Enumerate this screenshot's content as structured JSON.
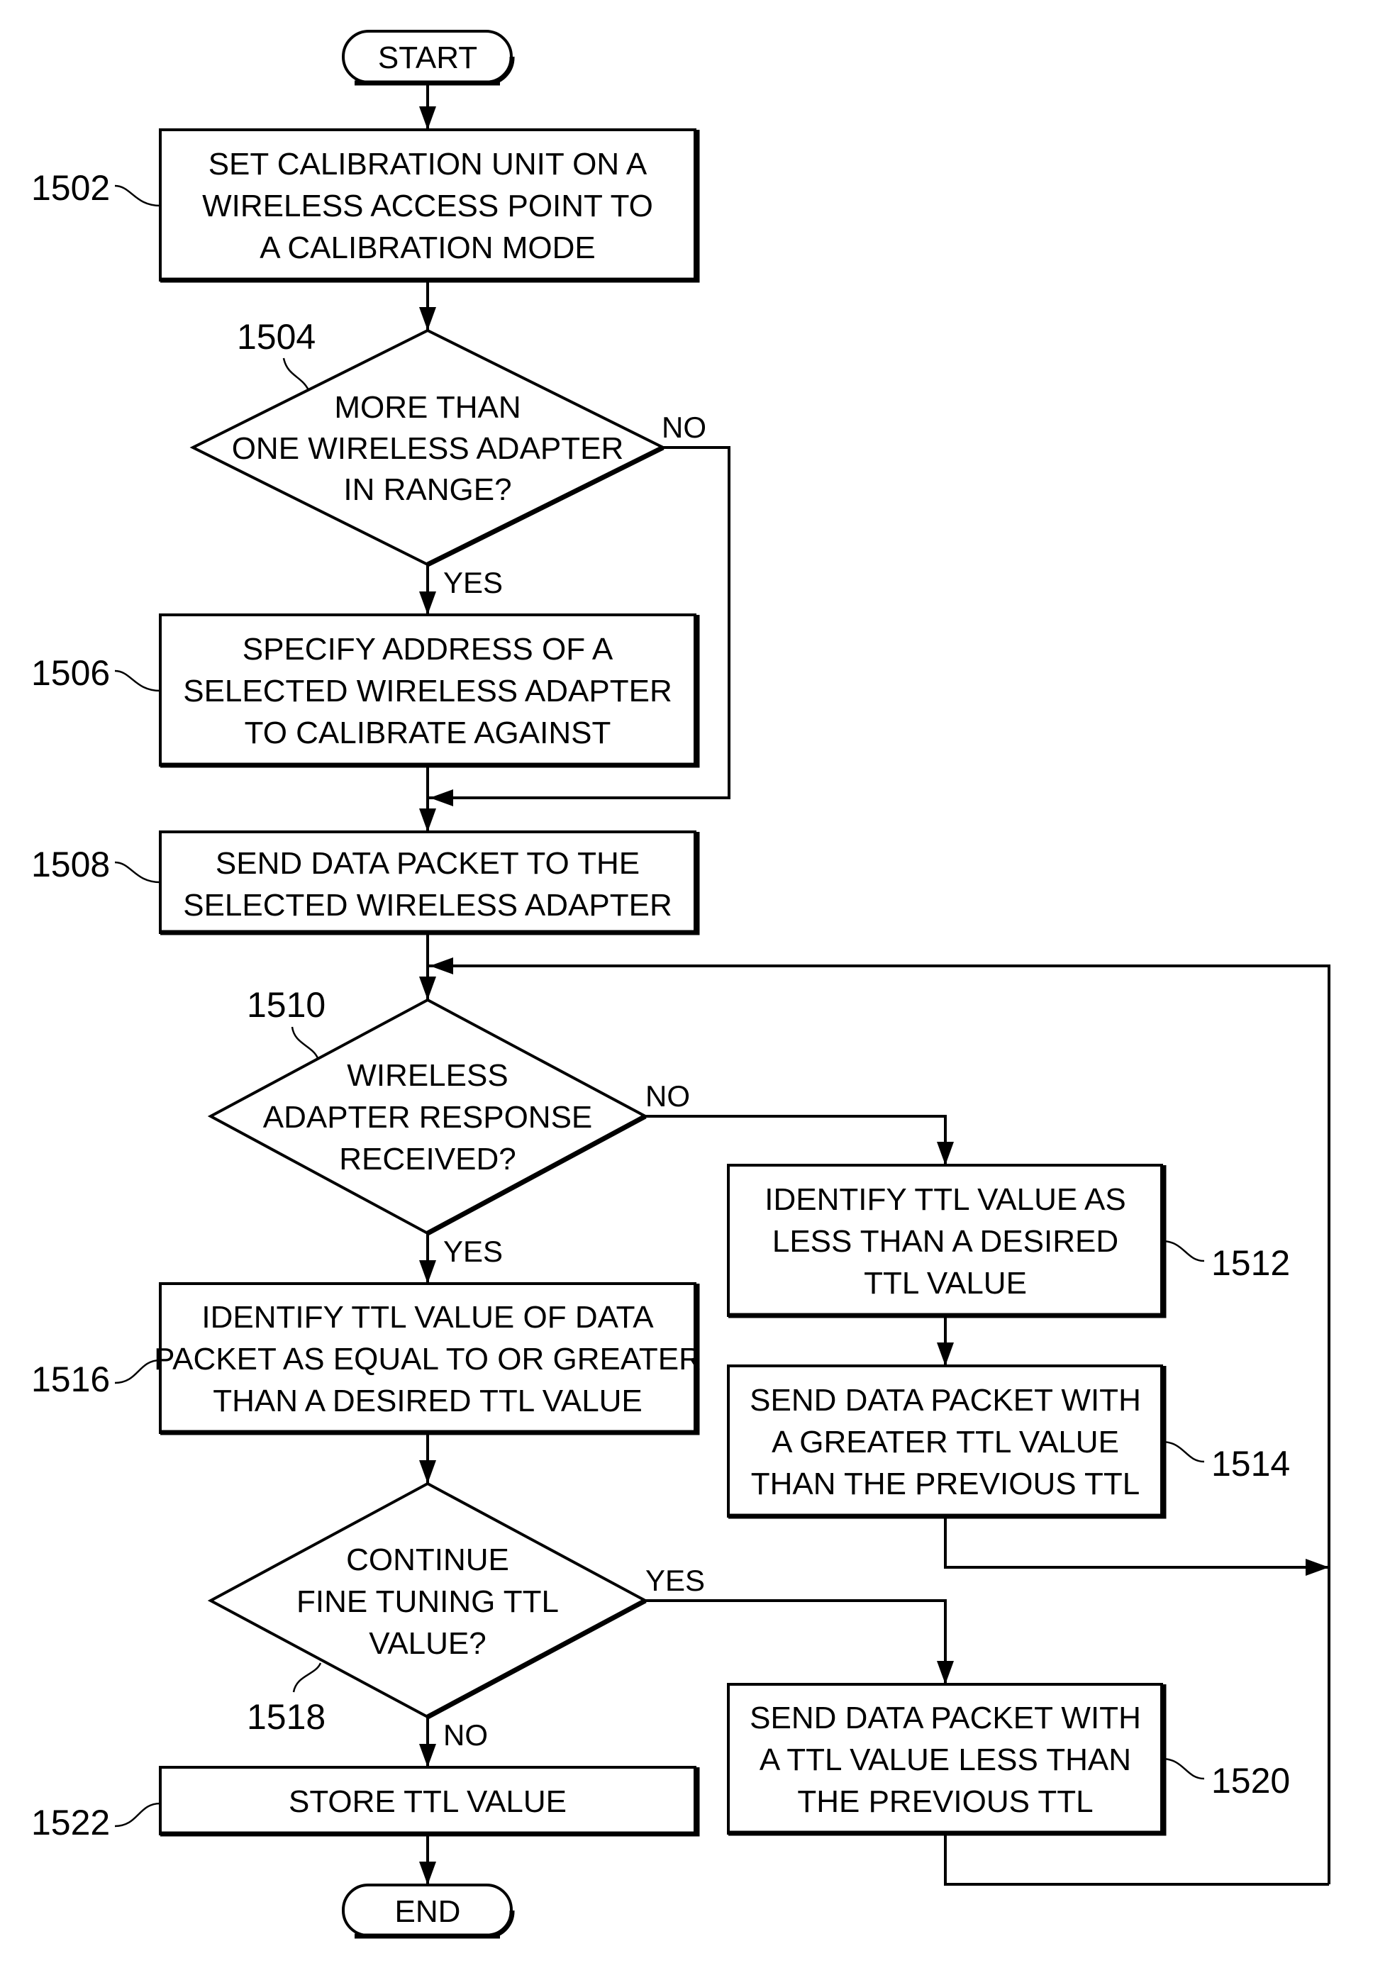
{
  "diagram": {
    "type": "flowchart",
    "terminals": {
      "start": "START",
      "end": "END"
    },
    "nodes": {
      "n1502": {
        "ref": "1502",
        "kind": "process",
        "lines": [
          "SET CALIBRATION UNIT ON A",
          "WIRELESS ACCESS POINT TO",
          "A CALIBRATION MODE"
        ]
      },
      "n1504": {
        "ref": "1504",
        "kind": "decision",
        "lines": [
          "MORE THAN",
          "ONE WIRELESS ADAPTER",
          "IN RANGE?"
        ]
      },
      "n1506": {
        "ref": "1506",
        "kind": "process",
        "lines": [
          "SPECIFY ADDRESS OF A",
          "SELECTED WIRELESS ADAPTER",
          "TO CALIBRATE AGAINST"
        ]
      },
      "n1508": {
        "ref": "1508",
        "kind": "process",
        "lines": [
          "SEND DATA PACKET TO THE",
          "SELECTED WIRELESS ADAPTER"
        ]
      },
      "n1510": {
        "ref": "1510",
        "kind": "decision",
        "lines": [
          "WIRELESS",
          "ADAPTER RESPONSE",
          "RECEIVED?"
        ]
      },
      "n1512": {
        "ref": "1512",
        "kind": "process",
        "lines": [
          "IDENTIFY TTL VALUE AS",
          "LESS THAN A DESIRED",
          "TTL VALUE"
        ]
      },
      "n1514": {
        "ref": "1514",
        "kind": "process",
        "lines": [
          "SEND DATA PACKET WITH",
          "A GREATER TTL VALUE",
          "THAN THE PREVIOUS TTL"
        ]
      },
      "n1516": {
        "ref": "1516",
        "kind": "process",
        "lines": [
          "IDENTIFY TTL VALUE OF DATA",
          "PACKET AS EQUAL TO OR GREATER",
          "THAN A DESIRED TTL VALUE"
        ]
      },
      "n1518": {
        "ref": "1518",
        "kind": "decision",
        "lines": [
          "CONTINUE",
          "FINE TUNING TTL",
          "VALUE?"
        ]
      },
      "n1520": {
        "ref": "1520",
        "kind": "process",
        "lines": [
          "SEND DATA PACKET WITH",
          "A TTL VALUE LESS THAN",
          "THE PREVIOUS TTL"
        ]
      },
      "n1522": {
        "ref": "1522",
        "kind": "process",
        "lines": [
          "STORE TTL VALUE"
        ]
      }
    },
    "branch_labels": {
      "b1504_no": "NO",
      "b1504_yes": "YES",
      "b1510_no": "NO",
      "b1510_yes": "YES",
      "b1518_yes": "YES",
      "b1518_no": "NO"
    },
    "edges": [
      {
        "from": "start",
        "to": "n1502"
      },
      {
        "from": "n1502",
        "to": "n1504"
      },
      {
        "from": "n1504",
        "to": "n1506",
        "label": "YES"
      },
      {
        "from": "n1504",
        "to": "n1508",
        "label": "NO"
      },
      {
        "from": "n1506",
        "to": "n1508"
      },
      {
        "from": "n1508",
        "to": "n1510"
      },
      {
        "from": "n1510",
        "to": "n1512",
        "label": "NO"
      },
      {
        "from": "n1510",
        "to": "n1516",
        "label": "YES"
      },
      {
        "from": "n1512",
        "to": "n1514"
      },
      {
        "from": "n1514",
        "to": "n1510"
      },
      {
        "from": "n1516",
        "to": "n1518"
      },
      {
        "from": "n1518",
        "to": "n1520",
        "label": "YES"
      },
      {
        "from": "n1518",
        "to": "n1522",
        "label": "NO"
      },
      {
        "from": "n1520",
        "to": "n1510"
      },
      {
        "from": "n1522",
        "to": "end"
      }
    ]
  }
}
